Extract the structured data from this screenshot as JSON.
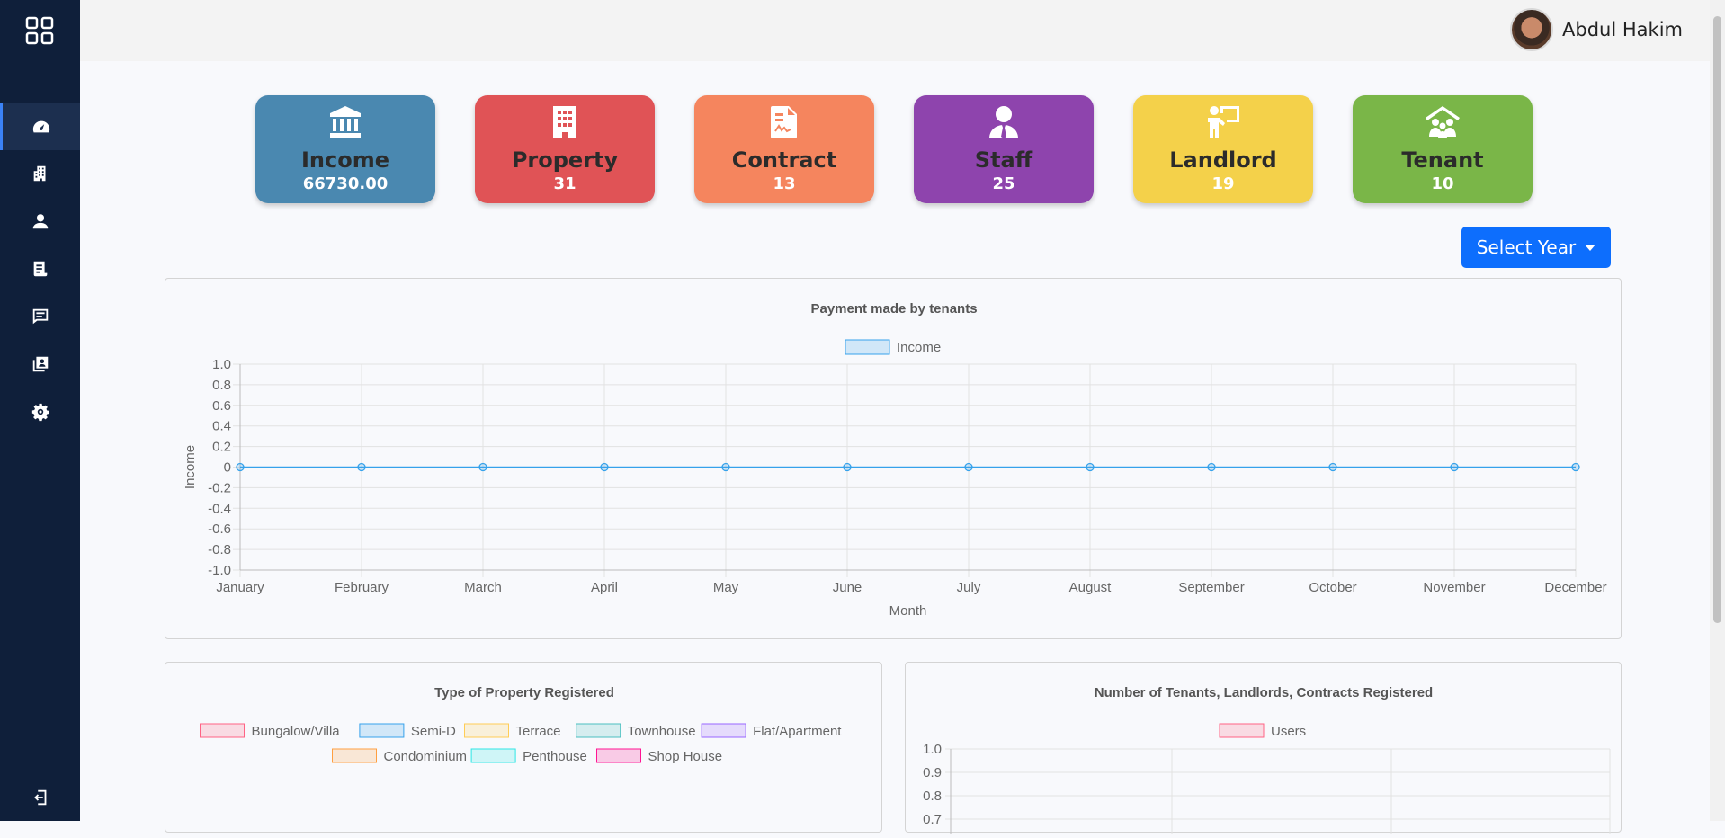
{
  "user": {
    "name": "Abdul Hakim"
  },
  "sidebar": {
    "items": [
      {
        "icon": "dashboard-icon"
      },
      {
        "icon": "building-icon"
      },
      {
        "icon": "user-icon"
      },
      {
        "icon": "document-icon"
      },
      {
        "icon": "message-icon"
      },
      {
        "icon": "contacts-icon"
      },
      {
        "icon": "gear-icon"
      }
    ],
    "logout_icon": "logout-icon"
  },
  "cards": [
    {
      "title": "Income",
      "value": "66730.00",
      "color": "#4a88b0",
      "icon": "bank-icon"
    },
    {
      "title": "Property",
      "value": "31",
      "color": "#e05356",
      "icon": "building-icon"
    },
    {
      "title": "Contract",
      "value": "13",
      "color": "#f5855e",
      "icon": "contract-icon"
    },
    {
      "title": "Staff",
      "value": "25",
      "color": "#8e44ad",
      "icon": "staff-icon"
    },
    {
      "title": "Landlord",
      "value": "19",
      "color": "#f4d14a",
      "icon": "landlord-icon"
    },
    {
      "title": "Tenant",
      "value": "10",
      "color": "#7ab648",
      "icon": "tenant-icon"
    }
  ],
  "year_button": {
    "label": "Select Year"
  },
  "chart_data": [
    {
      "type": "line",
      "title": "Payment made by tenants",
      "xlabel": "Month",
      "ylabel": "Income",
      "ylim": [
        -1.0,
        1.0
      ],
      "yticks": [
        "1.0",
        "0.8",
        "0.6",
        "0.4",
        "0.2",
        "0",
        "-0.2",
        "-0.4",
        "-0.6",
        "-0.8",
        "-1.0"
      ],
      "categories": [
        "January",
        "February",
        "March",
        "April",
        "May",
        "June",
        "July",
        "August",
        "September",
        "October",
        "November",
        "December"
      ],
      "series": [
        {
          "name": "Income",
          "values": [
            0,
            0,
            0,
            0,
            0,
            0,
            0,
            0,
            0,
            0,
            0,
            0
          ],
          "color": "#36a2eb"
        }
      ],
      "grid": true,
      "legend": "top"
    },
    {
      "type": "pie",
      "title": "Type of Property Registered",
      "legend": "top",
      "series": [
        {
          "name": "Bungalow/Villa",
          "color": "#ff6384"
        },
        {
          "name": "Semi-D",
          "color": "#36a2eb"
        },
        {
          "name": "Terrace",
          "color": "#ffcd56"
        },
        {
          "name": "Townhouse",
          "color": "#4bc0c0"
        },
        {
          "name": "Flat/Apartment",
          "color": "#9966ff"
        },
        {
          "name": "Condominium",
          "color": "#ff9f40"
        },
        {
          "name": "Penthouse",
          "color": "#2ce6e6"
        },
        {
          "name": "Shop House",
          "color": "#ff1493"
        }
      ]
    },
    {
      "type": "bar",
      "title": "Number of Tenants, Landlords, Contracts Registered",
      "legend": "top",
      "yticks": [
        "1.0",
        "0.9",
        "0.8",
        "0.7"
      ],
      "series": [
        {
          "name": "Users",
          "color": "#ff6384"
        }
      ],
      "grid": true
    }
  ]
}
